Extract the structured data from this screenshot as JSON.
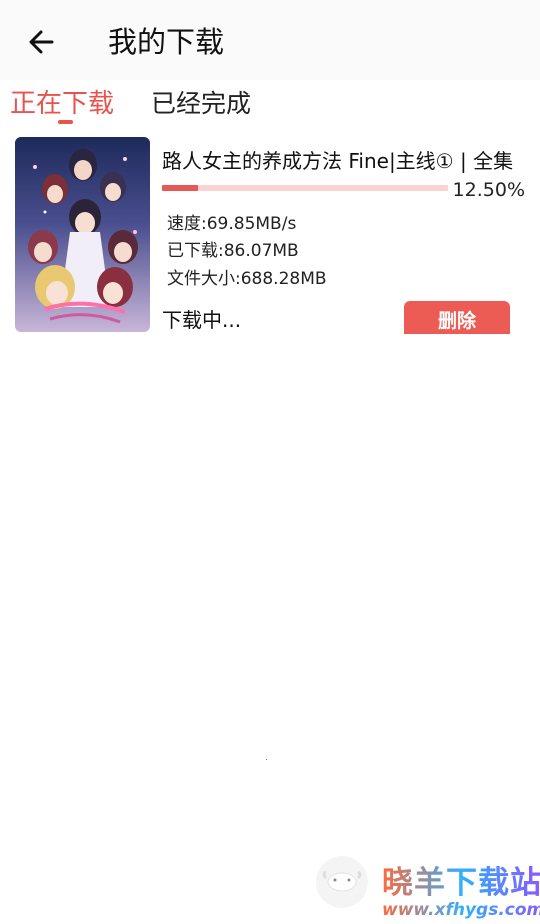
{
  "header": {
    "title": "我的下载",
    "back_icon": "arrow-left-icon"
  },
  "tabs": [
    {
      "label": "正在下载",
      "active": true
    },
    {
      "label": "已经完成",
      "active": false
    }
  ],
  "downloads": [
    {
      "title": "路人女主的养成方法 Fine|主线① | 全集",
      "progress_percent": 12.5,
      "progress_text": "12.50%",
      "speed": "速度:69.85MB/s",
      "downloaded": "已下载:86.07MB",
      "file_size": "文件大小:688.28MB",
      "status": "下载中...",
      "delete_label": "删除"
    }
  ],
  "watermark": {
    "name": "晓羊下载站",
    "url": "www.xfhygs.com"
  },
  "colors": {
    "accent": "#e8524f",
    "progress_track": "#f9d3d3",
    "progress_fill": "#e55a57",
    "delete_button": "#ec5c55",
    "header_bg": "#fafafa"
  }
}
